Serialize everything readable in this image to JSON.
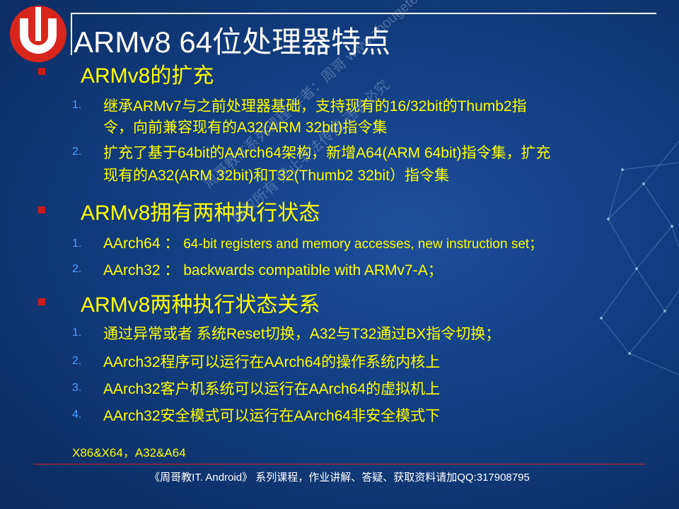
{
  "slide": {
    "title": "ARMv8 64位处理器特点",
    "sections": [
      {
        "heading": "ARMv8的扩充",
        "items": [
          {
            "number": "1.",
            "lines": [
              "继承ARMv7与之前处理器基础，支持现有的16/32bit的Thumb2指",
              "令，向前兼容现有的A32(ARM 32bit)指令集"
            ]
          },
          {
            "number": "2.",
            "lines": [
              "扩充了基于64bit的AArch64架构，新增A64(ARM 64bit)指令集，扩充",
              "现有的A32(ARM 32bit)和T32(Thumb2 32bit）指令集"
            ]
          }
        ]
      },
      {
        "heading": "ARMv8拥有两种执行状态",
        "items": [
          {
            "number": "1.",
            "label": "AArch64 ：",
            "desc": "64-bit registers and memory accesses, new instruction set；"
          },
          {
            "number": "2.",
            "label": "AArch32 ：",
            "desc": " backwards compatible with ARMv7-A；"
          }
        ]
      },
      {
        "heading": "ARMv8两种执行状态关系",
        "items": [
          {
            "number": "1.",
            "text": "通过异常或者 系统Reset切换，A32与T32通过BX指令切换；"
          },
          {
            "number": "2.",
            "text": "AArch32程序可以运行在AArch64的操作系统内核上"
          },
          {
            "number": "3.",
            "text": "AArch32客户机系统可以运行在AArch64的虚拟机上"
          },
          {
            "number": "4.",
            "text": "AArch32安全模式可以运行在AArch64非安全模式下"
          }
        ]
      }
    ],
    "note": "X86&X64，A32&A64",
    "footer": "《周哥教IT. Android》 系列课程，作业讲解、答疑、获取资料请加QQ:317908795",
    "watermark_lines": [
      "周哥教IT系列课程  作者：周哥  www.zhougetech.com",
      "版权所有  禁止非法传播  违者必究"
    ]
  },
  "colors": {
    "heading": "#ffff00",
    "bullet": "#cc1a1a",
    "number": "#4aa0ff",
    "title": "#ffffff"
  },
  "logo": {
    "icon": "u-shape-logo-icon"
  }
}
